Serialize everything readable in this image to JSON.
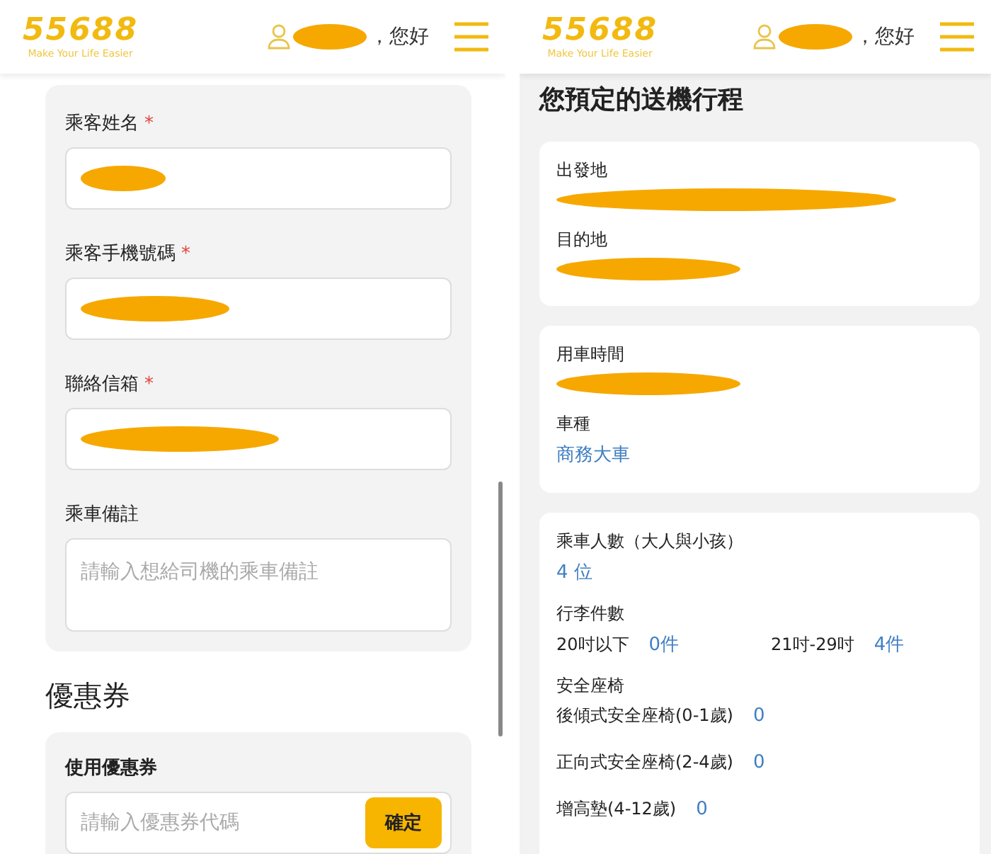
{
  "left_screen": {
    "header": {
      "logo": "55688",
      "tagline": "Make Your Life Easier",
      "greeting": "，您好"
    },
    "passenger_form": {
      "required_mark": "*",
      "fields": [
        {
          "label": "乘客姓名",
          "required": true
        },
        {
          "label": "乘客手機號碼",
          "required": true
        },
        {
          "label": "聯絡信箱",
          "required": true
        },
        {
          "label": "乘車備註",
          "required": false,
          "placeholder": "請輸入想給司機的乘車備註"
        }
      ]
    },
    "coupon": {
      "heading": "優惠券",
      "label": "使用優惠券",
      "placeholder": "請輸入優惠券代碼",
      "button": "確定"
    }
  },
  "right_screen": {
    "header": {
      "logo": "55688",
      "tagline": "Make Your Life Easier",
      "greeting": "，您好"
    },
    "title": "您預定的送機行程",
    "cards": [
      {
        "items": [
          {
            "kind": "redacted",
            "label": "出發地"
          },
          {
            "kind": "redacted",
            "label": "目的地"
          }
        ]
      },
      {
        "items": [
          {
            "kind": "redacted",
            "label": "用車時間"
          },
          {
            "kind": "value",
            "label": "車種",
            "value": "商務大車"
          }
        ]
      },
      {
        "items": [
          {
            "kind": "value",
            "label": "乘車人數（大人與小孩）",
            "value": "4 位"
          },
          {
            "kind": "pairs",
            "label": "行李件數",
            "pairs": [
              {
                "label": "20吋以下",
                "value": "0件"
              },
              {
                "label": "21吋-29吋",
                "value": "4件"
              }
            ]
          },
          {
            "kind": "rows",
            "label": "安全座椅",
            "rows": [
              {
                "label": "後傾式安全座椅(0-1歲)",
                "value": "0"
              },
              {
                "label": "正向式安全座椅(2-4歲)",
                "value": "0"
              },
              {
                "label": "增高墊(4-12歲)",
                "value": "0"
              }
            ]
          }
        ]
      }
    ]
  }
}
